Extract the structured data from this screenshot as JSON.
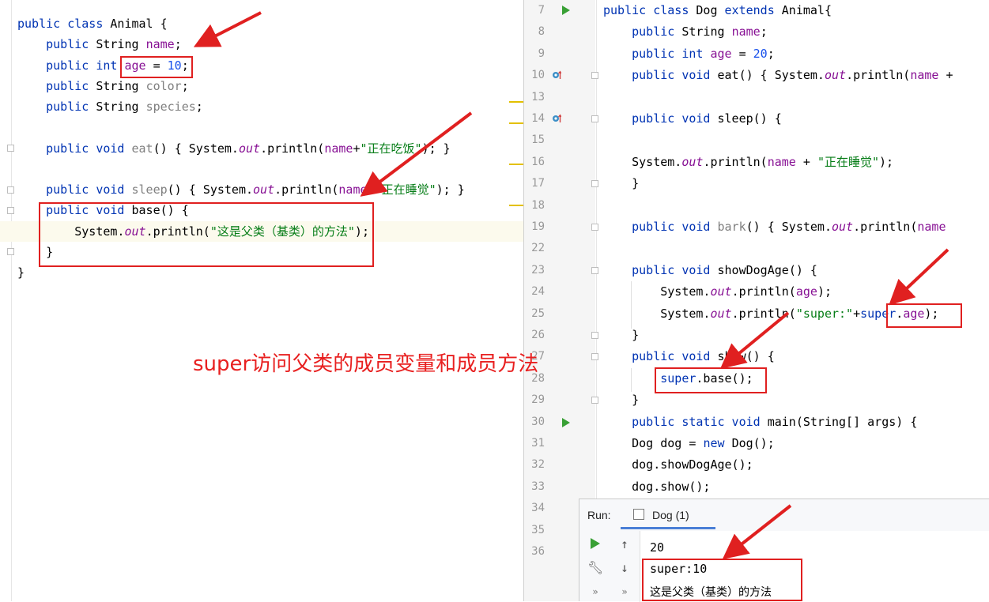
{
  "left_editor": {
    "lines": [
      {
        "tokens": [
          {
            "t": "public class ",
            "c": "kw"
          },
          {
            "t": "Animal {",
            "c": "plain"
          }
        ]
      },
      {
        "tokens": [
          {
            "t": "    public ",
            "c": "kw"
          },
          {
            "t": "String ",
            "c": "plain"
          },
          {
            "t": "name",
            "c": "fld"
          },
          {
            "t": ";",
            "c": "plain"
          }
        ]
      },
      {
        "tokens": [
          {
            "t": "    public int ",
            "c": "kw"
          },
          {
            "t": "age",
            "c": "fld"
          },
          {
            "t": " = ",
            "c": "plain"
          },
          {
            "t": "10",
            "c": "num"
          },
          {
            "t": ";",
            "c": "plain"
          }
        ]
      },
      {
        "tokens": [
          {
            "t": "    public ",
            "c": "kw"
          },
          {
            "t": "String ",
            "c": "plain"
          },
          {
            "t": "color",
            "c": "gray"
          },
          {
            "t": ";",
            "c": "plain"
          }
        ]
      },
      {
        "tokens": [
          {
            "t": "    public ",
            "c": "kw"
          },
          {
            "t": "String ",
            "c": "plain"
          },
          {
            "t": "species",
            "c": "gray"
          },
          {
            "t": ";",
            "c": "plain"
          }
        ]
      },
      {
        "tokens": []
      },
      {
        "tokens": [
          {
            "t": "    public void ",
            "c": "kw"
          },
          {
            "t": "eat",
            "c": "gray"
          },
          {
            "t": "() ",
            "c": "plain"
          },
          {
            "t": "{ ",
            "c": "plain"
          },
          {
            "t": "System.",
            "c": "plain"
          },
          {
            "t": "out",
            "c": "it"
          },
          {
            "t": ".println(",
            "c": "plain"
          },
          {
            "t": "name",
            "c": "fld"
          },
          {
            "t": "+",
            "c": "plain"
          },
          {
            "t": "\"正在吃饭\"",
            "c": "str"
          },
          {
            "t": "); }",
            "c": "plain"
          }
        ]
      },
      {
        "tokens": []
      },
      {
        "tokens": [
          {
            "t": "    public void ",
            "c": "kw"
          },
          {
            "t": "sleep",
            "c": "gray"
          },
          {
            "t": "() ",
            "c": "plain"
          },
          {
            "t": "{ ",
            "c": "plain"
          },
          {
            "t": "System.",
            "c": "plain"
          },
          {
            "t": "out",
            "c": "it"
          },
          {
            "t": ".println(",
            "c": "plain"
          },
          {
            "t": "name",
            "c": "fld"
          },
          {
            "t": "+",
            "c": "plain"
          },
          {
            "t": "\"正在睡觉\"",
            "c": "str"
          },
          {
            "t": "); }",
            "c": "plain"
          }
        ]
      },
      {
        "tokens": [
          {
            "t": "    public void ",
            "c": "kw"
          },
          {
            "t": "base",
            "c": "plain"
          },
          {
            "t": "() {",
            "c": "plain"
          }
        ]
      },
      {
        "tokens": [
          {
            "t": "        System.",
            "c": "plain"
          },
          {
            "t": "out",
            "c": "it"
          },
          {
            "t": ".println(",
            "c": "plain"
          },
          {
            "t": "\"这是父类（基类）的方法\"",
            "c": "str"
          },
          {
            "t": ");",
            "c": "plain"
          }
        ]
      },
      {
        "tokens": [
          {
            "t": "    }",
            "c": "plain"
          }
        ]
      },
      {
        "tokens": [
          {
            "t": "}",
            "c": "plain"
          }
        ]
      }
    ]
  },
  "right_editor": {
    "lines": [
      {
        "num": "7",
        "tokens": [
          {
            "t": "public class ",
            "c": "kw"
          },
          {
            "t": "Dog ",
            "c": "plain"
          },
          {
            "t": "extends ",
            "c": "kw"
          },
          {
            "t": "Animal{",
            "c": "plain"
          }
        ]
      },
      {
        "num": "8",
        "tokens": [
          {
            "t": "    public ",
            "c": "kw"
          },
          {
            "t": "String ",
            "c": "plain"
          },
          {
            "t": "name",
            "c": "fld"
          },
          {
            "t": ";",
            "c": "plain"
          }
        ]
      },
      {
        "num": "9",
        "tokens": [
          {
            "t": "    public int ",
            "c": "kw"
          },
          {
            "t": "age",
            "c": "fld"
          },
          {
            "t": " = ",
            "c": "plain"
          },
          {
            "t": "20",
            "c": "num"
          },
          {
            "t": ";",
            "c": "plain"
          }
        ]
      },
      {
        "num": "10",
        "tokens": [
          {
            "t": "    public void ",
            "c": "kw"
          },
          {
            "t": "eat",
            "c": "plain"
          },
          {
            "t": "() { ",
            "c": "plain"
          },
          {
            "t": "System.",
            "c": "plain"
          },
          {
            "t": "out",
            "c": "it"
          },
          {
            "t": ".println(",
            "c": "plain"
          },
          {
            "t": "name",
            "c": "fld"
          },
          {
            "t": " +",
            "c": "plain"
          }
        ]
      },
      {
        "num": "13",
        "tokens": []
      },
      {
        "num": "14",
        "tokens": [
          {
            "t": "    public void ",
            "c": "kw"
          },
          {
            "t": "sleep",
            "c": "plain"
          },
          {
            "t": "() {",
            "c": "plain"
          }
        ]
      },
      {
        "num": "15",
        "tokens": []
      },
      {
        "num": "16",
        "tokens": [
          {
            "t": "    System.",
            "c": "plain"
          },
          {
            "t": "out",
            "c": "it"
          },
          {
            "t": ".println(",
            "c": "plain"
          },
          {
            "t": "name",
            "c": "fld"
          },
          {
            "t": " + ",
            "c": "plain"
          },
          {
            "t": "\"正在睡觉\"",
            "c": "str"
          },
          {
            "t": ");",
            "c": "plain"
          }
        ]
      },
      {
        "num": "17",
        "tokens": [
          {
            "t": "    }",
            "c": "plain"
          }
        ]
      },
      {
        "num": "18",
        "tokens": []
      },
      {
        "num": "19",
        "tokens": [
          {
            "t": "    public void ",
            "c": "kw"
          },
          {
            "t": "bark",
            "c": "gray"
          },
          {
            "t": "() { ",
            "c": "plain"
          },
          {
            "t": "System.",
            "c": "plain"
          },
          {
            "t": "out",
            "c": "it"
          },
          {
            "t": ".println(",
            "c": "plain"
          },
          {
            "t": "name",
            "c": "fld"
          }
        ]
      },
      {
        "num": "22",
        "tokens": []
      },
      {
        "num": "23",
        "tokens": [
          {
            "t": "    public void ",
            "c": "kw"
          },
          {
            "t": "showDogAge",
            "c": "plain"
          },
          {
            "t": "() {",
            "c": "plain"
          }
        ]
      },
      {
        "num": "24",
        "tokens": [
          {
            "t": "        System.",
            "c": "plain"
          },
          {
            "t": "out",
            "c": "it"
          },
          {
            "t": ".println(",
            "c": "plain"
          },
          {
            "t": "age",
            "c": "fld"
          },
          {
            "t": ");",
            "c": "plain"
          }
        ]
      },
      {
        "num": "25",
        "tokens": [
          {
            "t": "        System.",
            "c": "plain"
          },
          {
            "t": "out",
            "c": "it"
          },
          {
            "t": ".println(",
            "c": "plain"
          },
          {
            "t": "\"super:\"",
            "c": "str"
          },
          {
            "t": "+",
            "c": "plain"
          },
          {
            "t": "super",
            "c": "kw"
          },
          {
            "t": ".",
            "c": "plain"
          },
          {
            "t": "age",
            "c": "fld"
          },
          {
            "t": ");",
            "c": "plain"
          }
        ]
      },
      {
        "num": "26",
        "tokens": [
          {
            "t": "    }",
            "c": "plain"
          }
        ]
      },
      {
        "num": "27",
        "tokens": [
          {
            "t": "    public void ",
            "c": "kw"
          },
          {
            "t": "show",
            "c": "plain"
          },
          {
            "t": "() {",
            "c": "plain"
          }
        ]
      },
      {
        "num": "28",
        "tokens": [
          {
            "t": "        ",
            "c": "plain"
          },
          {
            "t": "super",
            "c": "kw"
          },
          {
            "t": ".base();",
            "c": "plain"
          }
        ]
      },
      {
        "num": "29",
        "tokens": [
          {
            "t": "    }",
            "c": "plain"
          }
        ]
      },
      {
        "num": "30",
        "tokens": [
          {
            "t": "    public static void ",
            "c": "kw"
          },
          {
            "t": "main",
            "c": "plain"
          },
          {
            "t": "(String[] args) {",
            "c": "plain"
          }
        ]
      },
      {
        "num": "31",
        "tokens": [
          {
            "t": "    Dog dog = ",
            "c": "plain"
          },
          {
            "t": "new ",
            "c": "kw"
          },
          {
            "t": "Dog();",
            "c": "plain"
          }
        ]
      },
      {
        "num": "32",
        "tokens": [
          {
            "t": "    dog.showDogAge();",
            "c": "plain"
          }
        ]
      },
      {
        "num": "33",
        "tokens": [
          {
            "t": "    dog.show();",
            "c": "plain"
          }
        ]
      },
      {
        "num": "34",
        "tokens": []
      },
      {
        "num": "35",
        "tokens": []
      },
      {
        "num": "36",
        "tokens": []
      }
    ]
  },
  "run_panel": {
    "label": "Run:",
    "tab": "Dog (1)",
    "output": [
      "20",
      "super:10",
      "这是父类（基类）的方法"
    ]
  },
  "annotation": {
    "caption": "super访问父类的成员变量和成员方法",
    "color": "#e82020"
  },
  "colors": {
    "keyword": "#0033b3",
    "field": "#871094",
    "number": "#1750eb",
    "string": "#067d17",
    "run_green": "#39a035"
  }
}
